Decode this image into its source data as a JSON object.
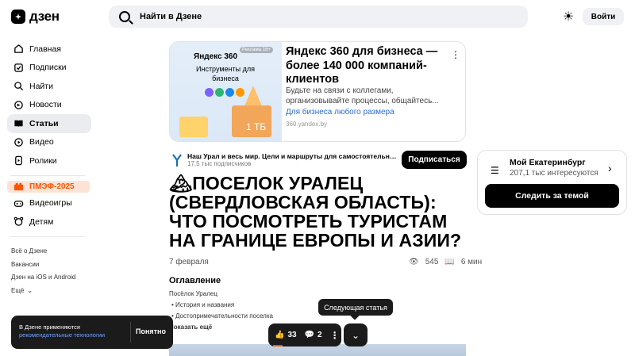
{
  "header": {
    "logo_text": "дзен",
    "search_placeholder": "Найти в Дзене",
    "login_label": "Войти"
  },
  "sidebar": {
    "items": [
      {
        "label": "Главная",
        "icon": "home-icon"
      },
      {
        "label": "Подписки",
        "icon": "subscriptions-icon"
      },
      {
        "label": "Найти",
        "icon": "search-icon"
      },
      {
        "label": "Новости",
        "icon": "news-icon"
      },
      {
        "label": "Статьи",
        "icon": "articles-icon"
      },
      {
        "label": "Видео",
        "icon": "video-icon"
      },
      {
        "label": "Ролики",
        "icon": "shorts-icon"
      }
    ],
    "promo": "ПМЭФ-2025",
    "extra_items": [
      {
        "label": "Видеоигры",
        "icon": "gamepad-icon"
      },
      {
        "label": "Детям",
        "icon": "kids-icon"
      }
    ],
    "footer_links": [
      "Всё о Дзене",
      "Вакансии",
      "Дзен на iOS и Android",
      "Ещё"
    ]
  },
  "ad": {
    "image_logo": "Яндекс 360",
    "image_subtitle": "Инструменты для бизнеса",
    "image_badge": "Реклама 16+",
    "image_box_label": "1 ТБ",
    "title": "Яндекс 360 для бизнеса — более 140 000 компаний-клиентов",
    "description": "Будьте на связи с коллегами, организовывайте процессы, общайтесь...",
    "link": "Для бизнеса любого размера",
    "domain": "360.yandex.by"
  },
  "channel": {
    "name": "Наш Урал и весь мир. Цели и маршруты для самостоятельных...",
    "subscribers": "17,5 тыс подписчиков",
    "subscribe_label": "Подписаться"
  },
  "article": {
    "title": "🏔ПОСЕЛОК УРАЛЕЦ (СВЕРДЛОВСКАЯ ОБЛАСТЬ): ЧТО ПОСМОТРЕТЬ ТУРИСТАМ НА ГРАНИЦЕ ЕВРОПЫ И АЗИИ?",
    "date": "7 февраля",
    "views": "545",
    "read_time": "6 мин",
    "toc_title": "Оглавление",
    "toc": [
      "Посёлок Уралец",
      "• История и названия",
      "• Достопримечательности поселка",
      "Показать ещё"
    ]
  },
  "topic": {
    "name": "Мой Екатеринбург",
    "count": "207,1 тыс интересуются",
    "follow_label": "Следить за темой"
  },
  "cookie": {
    "text": "В Дзене применяются",
    "link": "рекомендательные технологии",
    "button": "Понятно"
  },
  "bottom_bar": {
    "likes": "33",
    "comments": "2",
    "next_tooltip": "Следующая статья"
  },
  "colors": {
    "accent": "#ff5500",
    "link": "#2a6bd6",
    "dark": "#1b1b1b"
  }
}
